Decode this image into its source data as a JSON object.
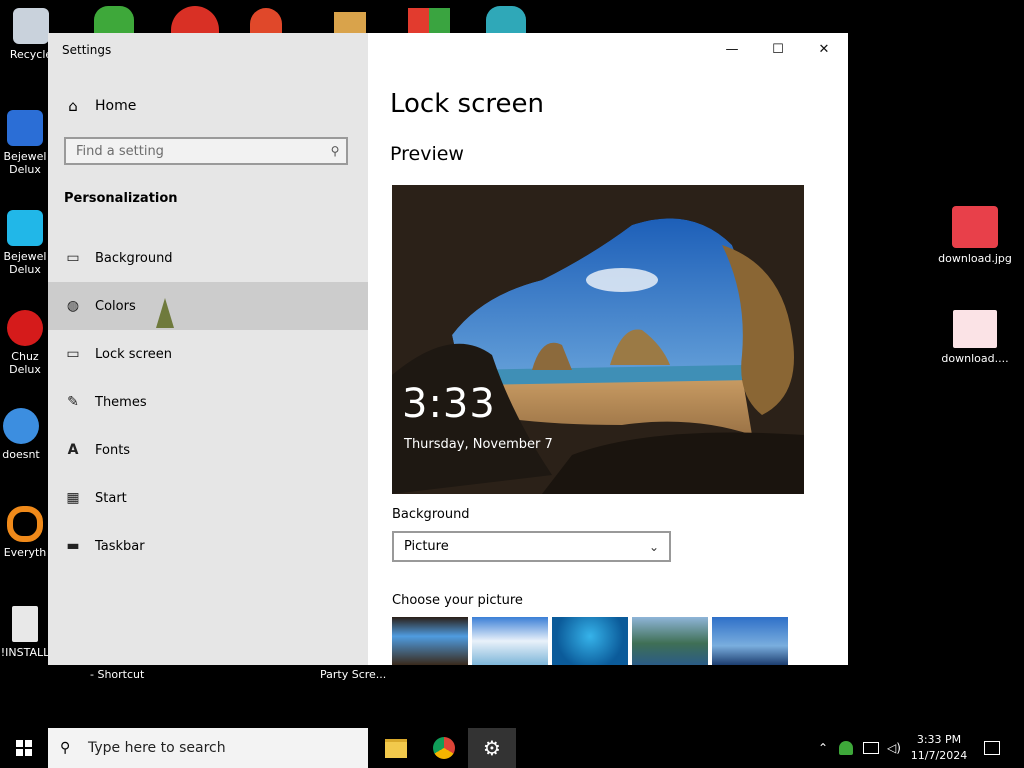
{
  "desktop": {
    "icons": [
      {
        "label": "Recycle",
        "color": "#c9d2dc"
      },
      {
        "label": "Bejewel\nDelux",
        "color": "#2b6ed6"
      },
      {
        "label": "Bejewel\nDelux",
        "color": "#21b7e8"
      },
      {
        "label": "Chuz\nDelux",
        "color": "#d51b1b"
      },
      {
        "label": "doesnt",
        "color": "#3c8ee0"
      },
      {
        "label": "Everyth",
        "color": "#f08a1a"
      },
      {
        "label": "!INSTALL",
        "color": "#e8e8e8"
      }
    ],
    "right_icons": [
      {
        "label": "download.jpg"
      },
      {
        "label": "download...."
      }
    ],
    "bottom_labels": [
      "- Shortcut",
      "Party Scre..."
    ]
  },
  "window": {
    "title": "Settings",
    "controls": {
      "minimize": "—",
      "maximize": "☐",
      "close": "✕"
    }
  },
  "sidebar": {
    "home": "Home",
    "search_placeholder": "Find a setting",
    "section": "Personalization",
    "items": [
      {
        "label": "Background",
        "icon": "image-icon"
      },
      {
        "label": "Colors",
        "icon": "palette-icon"
      },
      {
        "label": "Lock screen",
        "icon": "lock-screen-icon"
      },
      {
        "label": "Themes",
        "icon": "themes-icon"
      },
      {
        "label": "Fonts",
        "icon": "fonts-icon"
      },
      {
        "label": "Start",
        "icon": "start-icon"
      },
      {
        "label": "Taskbar",
        "icon": "taskbar-icon"
      }
    ]
  },
  "main": {
    "title": "Lock screen",
    "preview_heading": "Preview",
    "preview_time": "3:33",
    "preview_date": "Thursday, November 7",
    "background_label": "Background",
    "background_value": "Picture",
    "choose_picture_label": "Choose your picture"
  },
  "taskbar": {
    "search_placeholder": "Type here to search",
    "time": "3:33 PM",
    "date": "11/7/2024"
  }
}
